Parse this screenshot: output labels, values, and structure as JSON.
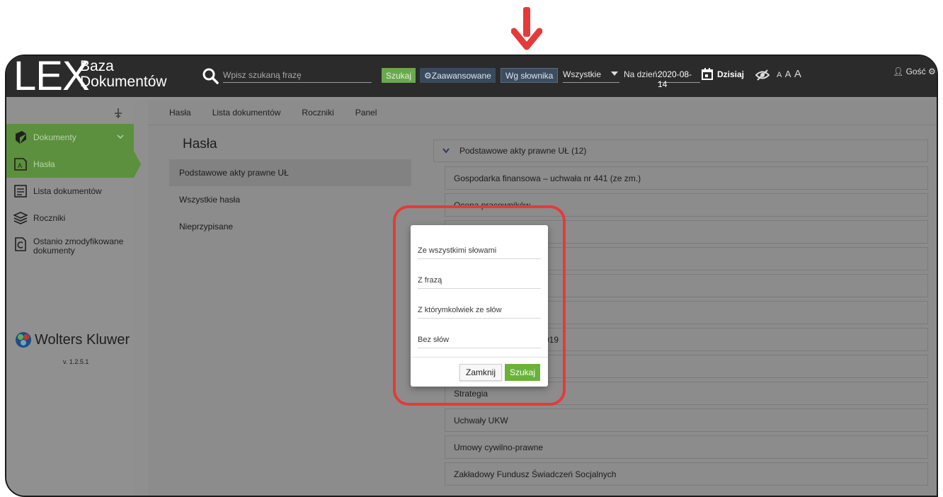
{
  "header": {
    "logo_main": "LEX",
    "logo_line1": "Baza",
    "logo_line2": "Dokumentów",
    "search_placeholder": "Wpisz szukaną frazę",
    "search_button": "Szukaj",
    "advanced_button": "Zaawansowane",
    "dictionary_button": "Wg słownika",
    "scope_select": "Wszystkie",
    "date_label": "Na dzień:",
    "date_value": "2020-08-14",
    "today_label": "Dzisiaj",
    "font_sizes": [
      "A",
      "A",
      "A"
    ],
    "user_label": "Gość"
  },
  "sidebar": {
    "items": [
      {
        "label": "Dokumenty",
        "icon": "book-icon"
      },
      {
        "label": "Hasła",
        "icon": "tag-icon"
      },
      {
        "label": "Lista dokumentów",
        "icon": "list-icon"
      },
      {
        "label": "Roczniki",
        "icon": "layers-icon"
      },
      {
        "label": "Ostanio zmodyfikowane dokumenty",
        "icon": "modified-doc-icon"
      }
    ],
    "brand": "Wolters Kluwer",
    "version": "v. 1.2.5.1"
  },
  "tabs": [
    "Hasła",
    "Lista dokumentów",
    "Roczniki",
    "Panel"
  ],
  "main": {
    "title": "Hasła",
    "left_list": [
      "Podstawowe akty prawne UŁ",
      "Wszystkie hasła",
      "Nieprzypisane"
    ],
    "tree_head": "Podstawowe akty prawne UŁ (12)",
    "tree_rows": [
      "Gospodarka finansowa – uchwała nr 441 (ze zm.)",
      "Ocena pracowników",
      "",
      "",
      "",
      "",
      "019",
      "",
      "Strategia",
      "Uchwały UKW",
      "Umowy cywilno-prawne",
      "Zakładowy Fundusz Świadczeń Socjalnych"
    ]
  },
  "modal": {
    "field_all": "Ze wszystkimi słowami",
    "field_phrase": "Z frazą",
    "field_any": "Z którymkolwiek ze słów",
    "field_without": "Bez słów",
    "close_button": "Zamknij",
    "search_button": "Szukaj"
  },
  "colors": {
    "accent_green": "#6ab23a",
    "highlight_red": "#e53a3a",
    "topbar": "#2b2b2b"
  }
}
